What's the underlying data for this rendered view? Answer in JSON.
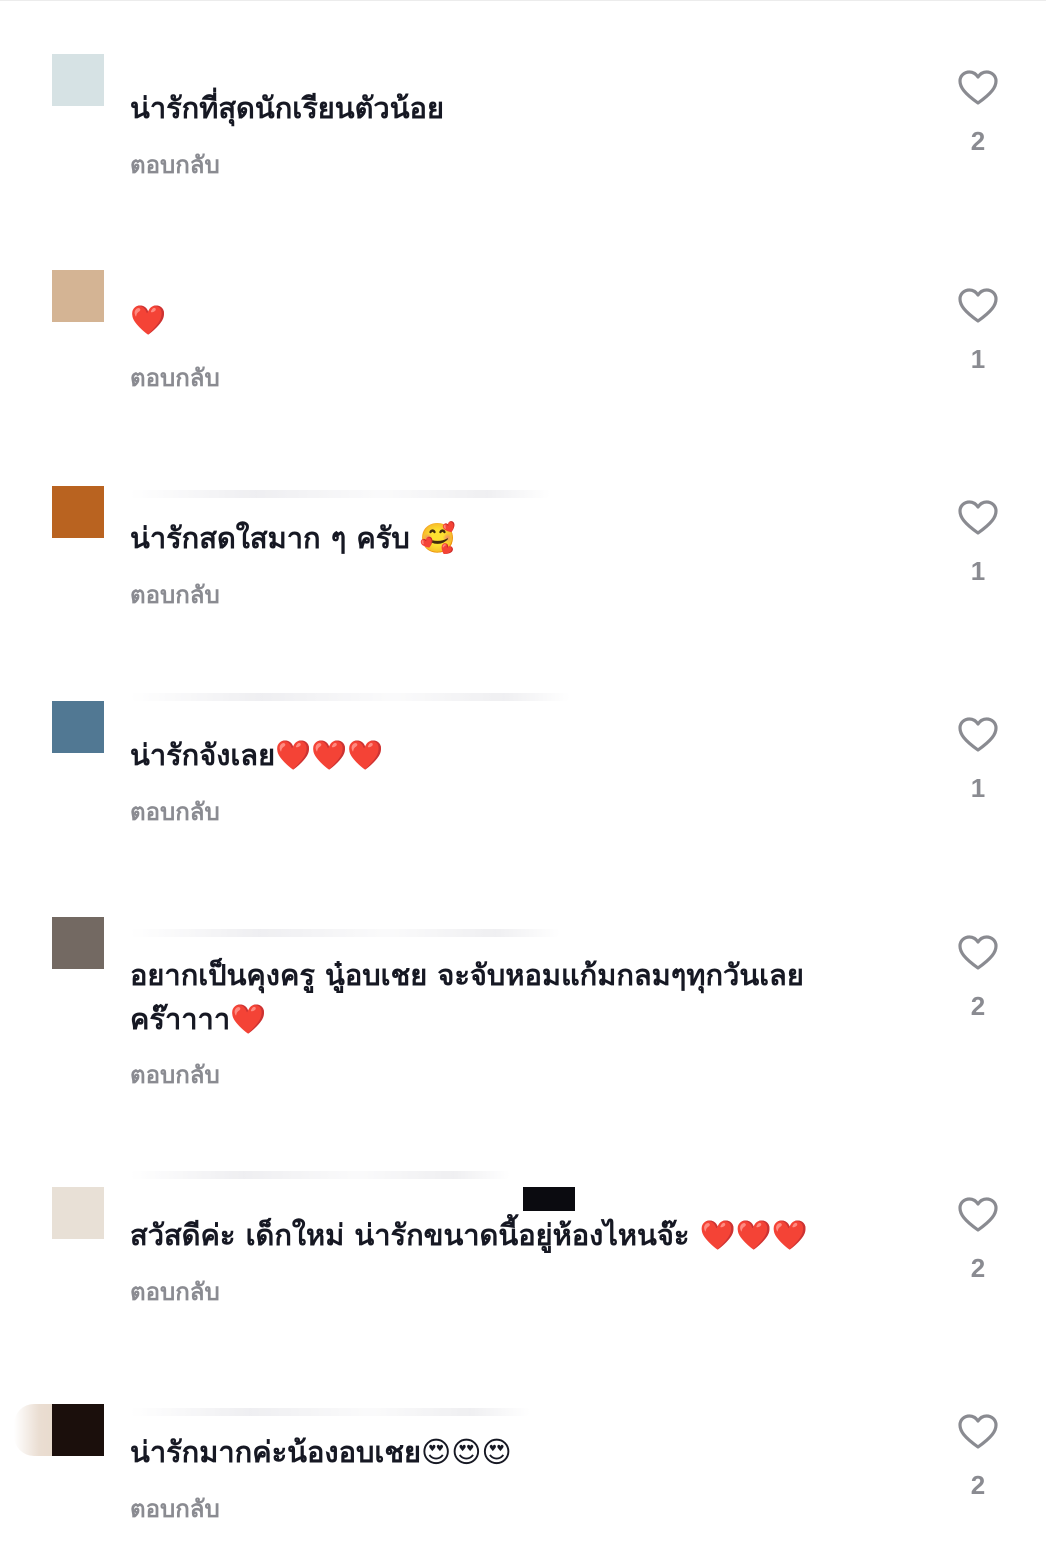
{
  "comments": [
    {
      "text": "น่ารักที่สุดนักเรียนตัวน้อย",
      "reply": "ตอบกลับ",
      "likes": "2",
      "avatar_color": "#d6e2e4"
    },
    {
      "text": "❤️",
      "reply": "ตอบกลับ",
      "likes": "1",
      "avatar_color": "#d4b494"
    },
    {
      "text": "น่ารักสดใสมาก ๆ ครับ 🥰",
      "reply": "ตอบกลับ",
      "likes": "1",
      "avatar_color": "#b96320"
    },
    {
      "text": "น่ารักจังเลย❤️❤️❤️",
      "reply": "ตอบกลับ",
      "likes": "1",
      "avatar_color": "#517893"
    },
    {
      "text": "อยากเป็นคุงครู นู๋อบเชย จะจับหอมแก้มกลมๆทุกวันเลย\nคร๊าาาา❤️",
      "reply": "ตอบกลับ",
      "likes": "2",
      "avatar_color": "#736962"
    },
    {
      "text": "สวัสดีค่ะ เด็กใหม่ น่ารักขนาดนี้อยู่ห้องไหนจ๊ะ ❤️❤️❤️",
      "reply": "ตอบกลับ",
      "likes": "2",
      "avatar_color": "#e8e0d6"
    },
    {
      "text": "น่ารักมากค่ะน้องอบเชย😍😍😍",
      "reply": "ตอบกลับ",
      "likes": "2",
      "avatar_color": "#1b0f0c"
    }
  ],
  "icons": {
    "like": "heart-outline-icon"
  }
}
